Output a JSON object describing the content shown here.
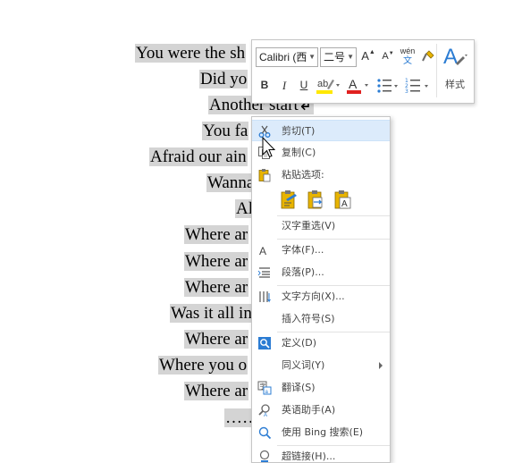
{
  "document": {
    "lines": [
      "You were the sh",
      "Did yo",
      "Another start↲",
      "You fa",
      "Afraid our ain",
      "Wanna",
      "Al",
      "Where ar",
      "Where ar",
      "Where ar",
      "Was it all in",
      "Where ar",
      "Where you o",
      "Where ar",
      "……"
    ]
  },
  "mini_toolbar": {
    "font_name": "Calibri (西",
    "font_size": "二号",
    "grow_font": "A",
    "shrink_font": "A",
    "phonetic_top": "wén",
    "phonetic_bottom": "文",
    "bold": "B",
    "italic": "I",
    "underline": "U",
    "font_color": "A",
    "styles_label": "样式"
  },
  "context_menu": {
    "cut": "剪切(T)",
    "copy": "复制(C)",
    "paste_options": "粘贴选项:",
    "reconvert": "汉字重选(V)",
    "font": "字体(F)...",
    "paragraph": "段落(P)...",
    "text_direction": "文字方向(X)...",
    "insert_symbol": "插入符号(S)",
    "define": "定义(D)",
    "synonyms": "同义词(Y)",
    "translate": "翻译(S)",
    "english_assistant": "英语助手(A)",
    "bing_search": "使用 Bing 搜索(E)",
    "hyperlink": "超链接(H)..."
  },
  "colors": {
    "selection": "#d4d4d4",
    "menu_hover": "#dcebfb",
    "accent_blue": "#2b7cd3",
    "font_color_red": "#e0201f",
    "highlight_yellow": "#ffe800"
  }
}
